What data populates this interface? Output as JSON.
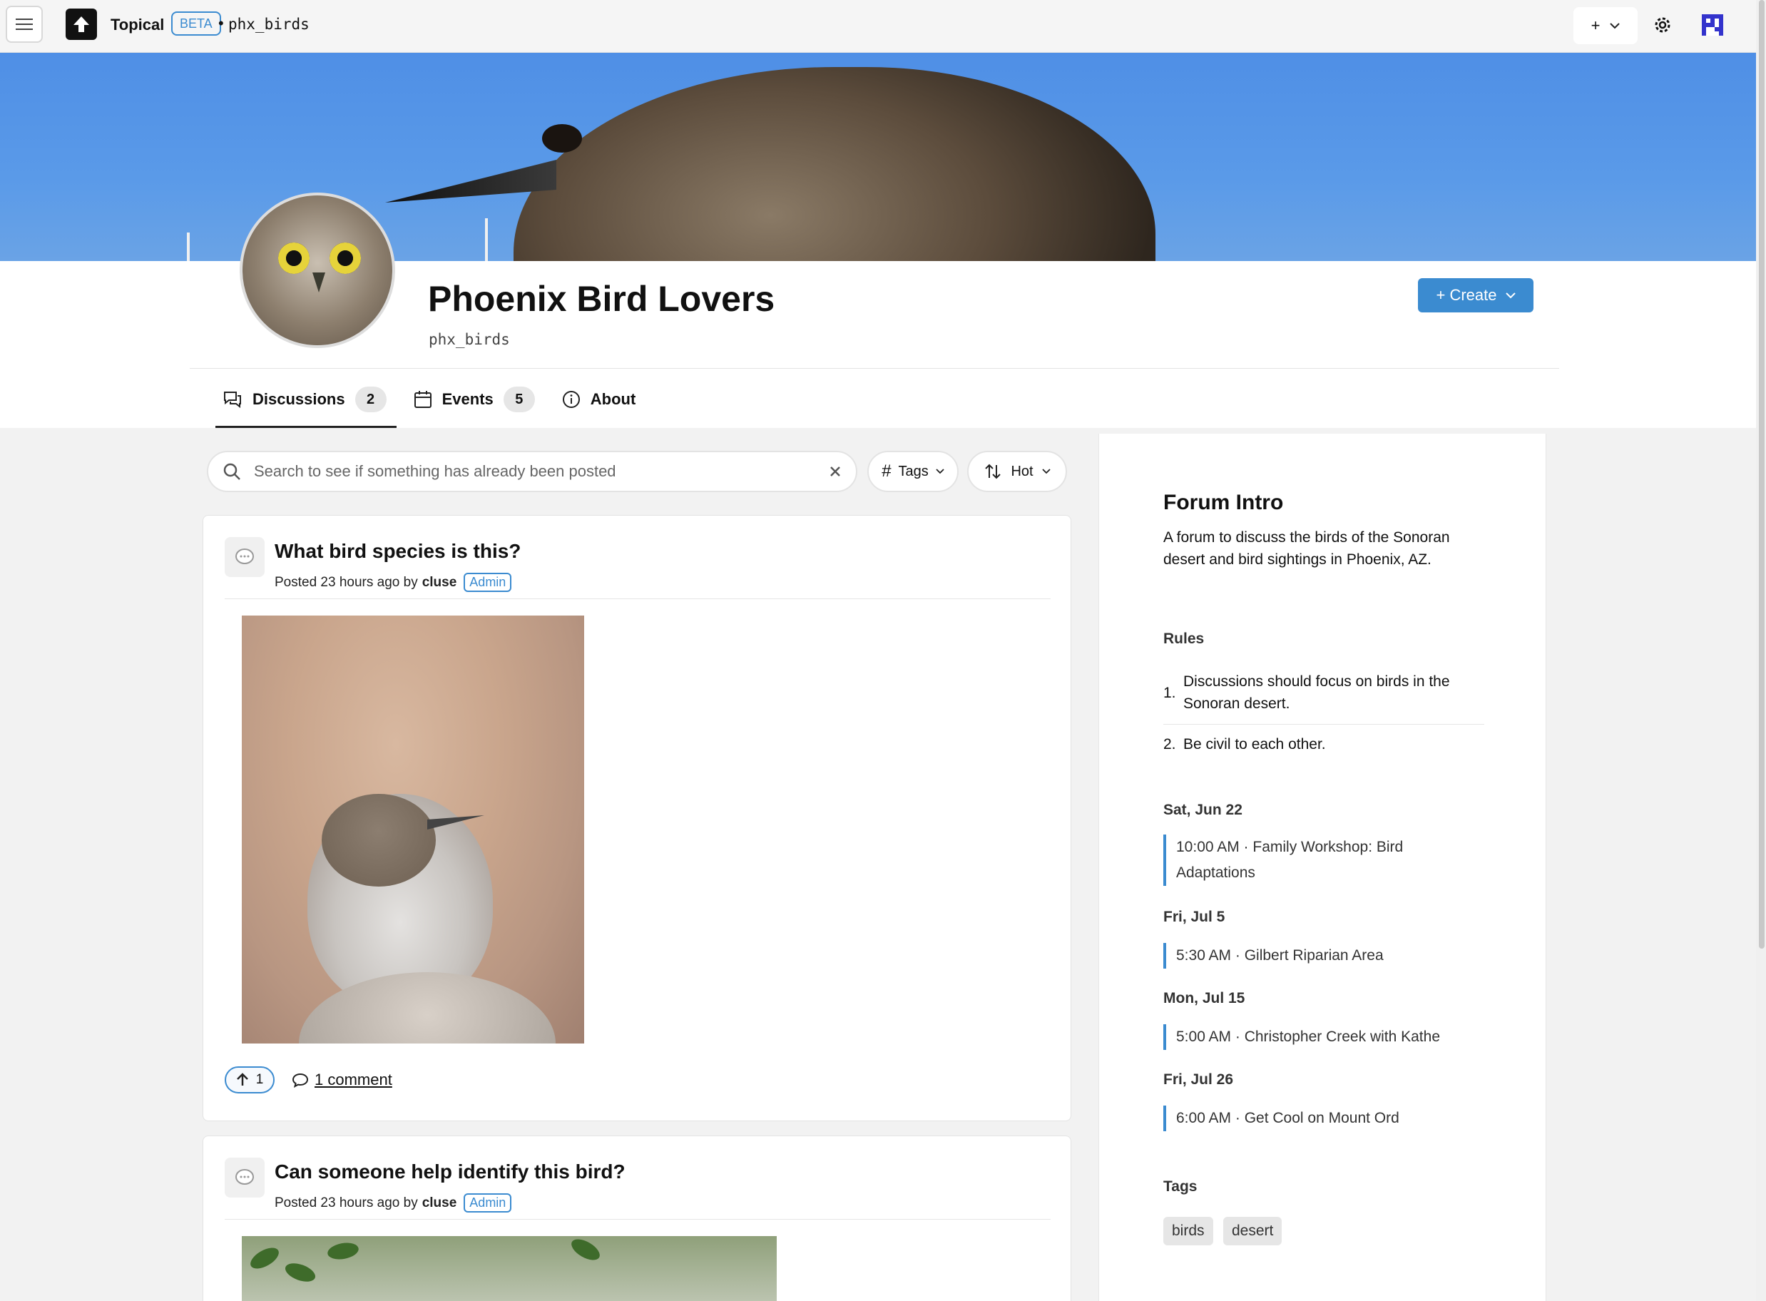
{
  "topbar": {
    "brand": "Topical",
    "beta": "BETA",
    "separator": "•",
    "breadcrumb": "phx_birds",
    "plus_label": "+"
  },
  "community": {
    "title": "Phoenix Bird Lovers",
    "handle": "phx_birds",
    "create_label": "+ Create"
  },
  "tabs": [
    {
      "label": "Discussions",
      "count": "2"
    },
    {
      "label": "Events",
      "count": "5"
    },
    {
      "label": "About"
    }
  ],
  "search": {
    "placeholder": "Search to see if something has already been posted",
    "tags_label": "Tags",
    "sort_label": "Hot"
  },
  "posts": [
    {
      "title": "What bird species is this?",
      "posted": "Posted 23 hours ago by",
      "author": "cluse",
      "badge": "Admin",
      "upvotes": "1",
      "comments": "1 comment"
    },
    {
      "title": "Can someone help identify this bird?",
      "posted": "Posted 23 hours ago by",
      "author": "cluse",
      "badge": "Admin"
    }
  ],
  "sidebar": {
    "intro_title": "Forum Intro",
    "intro_text": "A forum to discuss the birds of the Sonoran desert and bird sightings in Phoenix, AZ.",
    "rules_title": "Rules",
    "rules": [
      {
        "num": "1.",
        "text": "Discussions should focus on birds in the Sonoran desert."
      },
      {
        "num": "2.",
        "text": "Be civil to each other."
      }
    ],
    "events": [
      {
        "date": "Sat, Jun 22",
        "item": "10:00 AM · Family Workshop: Bird Adaptations"
      },
      {
        "date": "Fri, Jul 5",
        "item": "5:30 AM · Gilbert Riparian Area"
      },
      {
        "date": "Mon, Jul 15",
        "item": "5:00 AM · Christopher Creek with Kathe"
      },
      {
        "date": "Fri, Jul 26",
        "item": "6:00 AM · Get Cool on Mount Ord"
      }
    ],
    "tags_title": "Tags",
    "tags": [
      "birds",
      "desert"
    ]
  },
  "colors": {
    "accent": "#3b8bd0",
    "banner_sky": "#5a9ae8",
    "user_avatar": "#3333cc"
  }
}
